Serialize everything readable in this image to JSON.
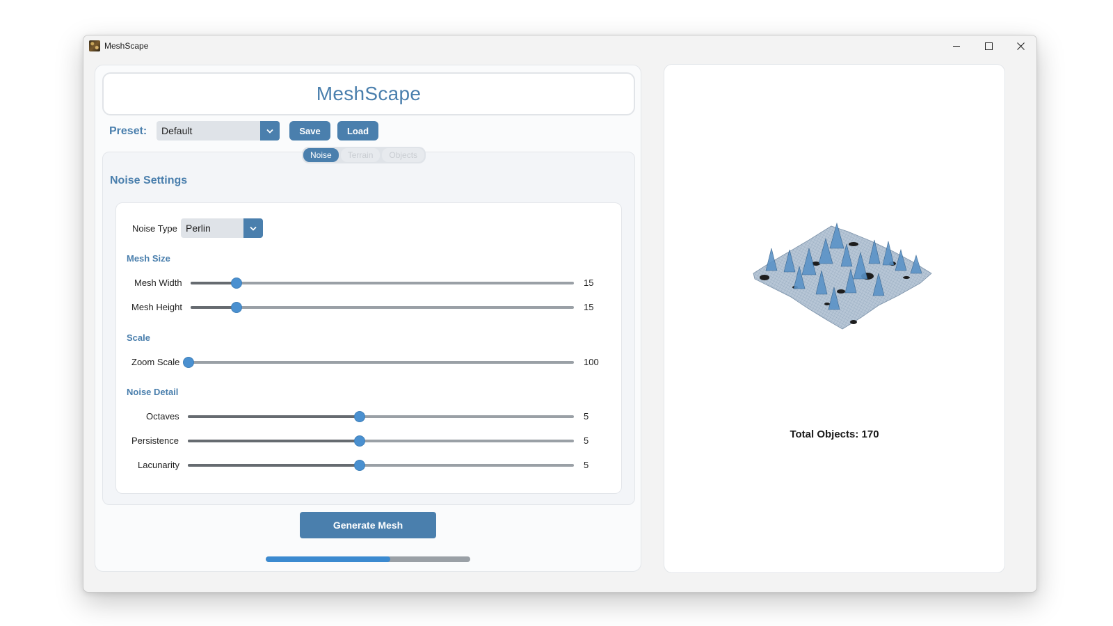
{
  "window": {
    "title": "MeshScape"
  },
  "header": {
    "title": "MeshScape"
  },
  "preset": {
    "label": "Preset:",
    "selected": "Default",
    "save_label": "Save",
    "load_label": "Load"
  },
  "tabs": [
    {
      "label": "Noise",
      "active": true
    },
    {
      "label": "Terrain",
      "active": false
    },
    {
      "label": "Objects",
      "active": false
    }
  ],
  "noise_settings": {
    "title": "Noise Settings",
    "noise_type": {
      "label": "Noise Type",
      "selected": "Perlin"
    },
    "groups": {
      "mesh_size": "Mesh Size",
      "scale": "Scale",
      "noise_detail": "Noise Detail"
    },
    "sliders": {
      "mesh_width": {
        "label": "Mesh Width",
        "value": "15",
        "fraction": 0.12
      },
      "mesh_height": {
        "label": "Mesh Height",
        "value": "15",
        "fraction": 0.12
      },
      "zoom_scale": {
        "label": "Zoom Scale",
        "value": "100",
        "fraction": 0.0
      },
      "octaves": {
        "label": "Octaves",
        "value": "5",
        "fraction": 0.445
      },
      "persistence": {
        "label": "Persistence",
        "value": "5",
        "fraction": 0.445
      },
      "lacunarity": {
        "label": "Lacunarity",
        "value": "5",
        "fraction": 0.445
      }
    }
  },
  "actions": {
    "generate_label": "Generate Mesh",
    "progress": 0.61
  },
  "preview": {
    "total_objects": "Total Objects: 170"
  },
  "colors": {
    "accent": "#4a7fad",
    "slider_thumb": "#4a90d0",
    "progress_fill": "#3b8ad0"
  }
}
